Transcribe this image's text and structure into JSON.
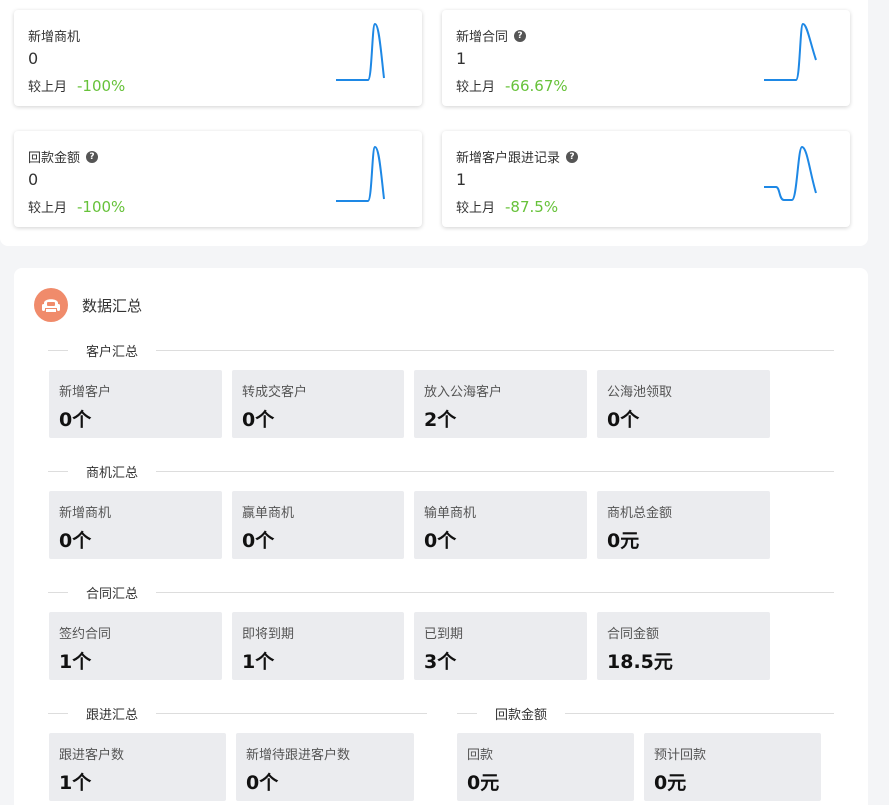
{
  "kpis": [
    {
      "title": "新增商机",
      "has_help": false,
      "value": "0",
      "compare_label": "较上月",
      "change": "-100%",
      "spark": "peak"
    },
    {
      "title": "新增合同",
      "has_help": true,
      "value": "1",
      "compare_label": "较上月",
      "change": "-66.67%",
      "spark": "peak"
    },
    {
      "title": "回款金额",
      "has_help": true,
      "value": "0",
      "compare_label": "较上月",
      "change": "-100%",
      "spark": "peak"
    },
    {
      "title": "新增客户跟进记录",
      "has_help": true,
      "value": "1",
      "compare_label": "较上月",
      "change": "-87.5%",
      "spark": "dip-peak"
    }
  ],
  "summary": {
    "title": "数据汇总",
    "sections": {
      "customer": {
        "label": "客户汇总",
        "items": [
          {
            "label": "新增客户",
            "value": "0个"
          },
          {
            "label": "转成交客户",
            "value": "0个"
          },
          {
            "label": "放入公海客户",
            "value": "2个"
          },
          {
            "label": "公海池领取",
            "value": "0个"
          }
        ]
      },
      "opportunity": {
        "label": "商机汇总",
        "items": [
          {
            "label": "新增商机",
            "value": "0个"
          },
          {
            "label": "赢单商机",
            "value": "0个"
          },
          {
            "label": "输单商机",
            "value": "0个"
          },
          {
            "label": "商机总金额",
            "value": "0元"
          }
        ]
      },
      "contract": {
        "label": "合同汇总",
        "items": [
          {
            "label": "签约合同",
            "value": "1个"
          },
          {
            "label": "即将到期",
            "value": "1个"
          },
          {
            "label": "已到期",
            "value": "3个"
          },
          {
            "label": "合同金额",
            "value": "18.5元"
          }
        ]
      },
      "followup": {
        "label": "跟进汇总",
        "items": [
          {
            "label": "跟进客户数",
            "value": "1个"
          },
          {
            "label": "新增待跟进客户数",
            "value": "0个"
          }
        ]
      },
      "payment": {
        "label": "回款金额",
        "items": [
          {
            "label": "回款",
            "value": "0元"
          },
          {
            "label": "预计回款",
            "value": "0元"
          }
        ]
      }
    }
  },
  "colors": {
    "spark": "#1e88e5",
    "change_positive": "#67c23a",
    "logo": "#f08b6b"
  }
}
